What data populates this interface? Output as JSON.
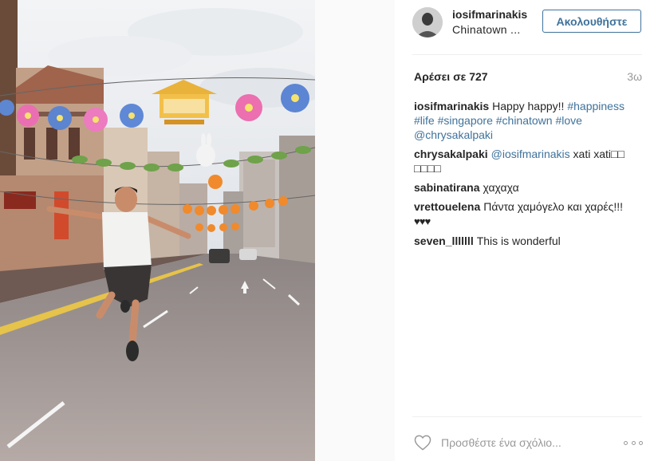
{
  "post": {
    "username": "iosifmarinakis",
    "location": "Chinatown ...",
    "follow_label": "Ακολουθήστε",
    "likes": "Αρέσει σε 727",
    "age": "3ω"
  },
  "caption": {
    "user": "iosifmarinakis",
    "text": "Happy happy!!",
    "tags": [
      "#happiness",
      "#life",
      "#singapore",
      "#chinatown",
      "#love",
      "@chrysakalpaki"
    ]
  },
  "comments": [
    {
      "user": "chrysakalpaki",
      "mention": "@iosifmarinakis",
      "text": "xati xati□□ □□□□"
    },
    {
      "user": "sabinatirana",
      "text": "χαχαχα"
    },
    {
      "user": "vrettouelena",
      "text": "Πάντα χαμόγελο και χαρές!!!",
      "extra": "♥♥♥"
    },
    {
      "user": "seven_lllllll",
      "text": "This is wonderful"
    }
  ],
  "footer": {
    "placeholder": "Προσθέστε ένα σχόλιο..."
  },
  "icons": {
    "like": "heart-icon",
    "more": "more-options-icon"
  },
  "colors": {
    "link": "#3f729b",
    "text": "#262626",
    "muted": "#999999",
    "divider": "#efefef"
  }
}
